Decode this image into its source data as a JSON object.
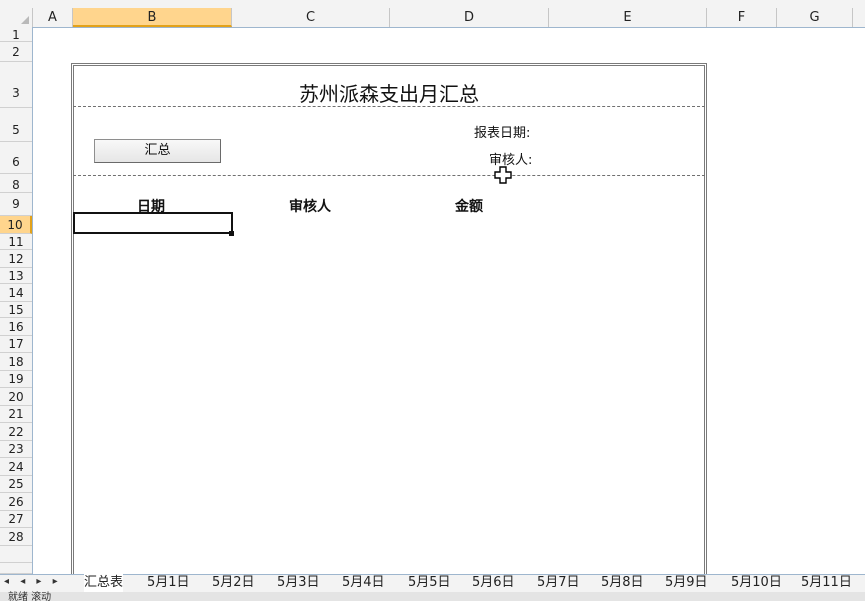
{
  "columns": [
    {
      "label": "A"
    },
    {
      "label": "B"
    },
    {
      "label": "C"
    },
    {
      "label": "D"
    },
    {
      "label": "E"
    },
    {
      "label": "F"
    },
    {
      "label": "G"
    }
  ],
  "rows": [
    "1",
    "2",
    "3",
    "5",
    "6",
    "8",
    "9",
    "10",
    "11",
    "12",
    "13",
    "14",
    "15",
    "16",
    "17",
    "18",
    "19",
    "20",
    "21",
    "22",
    "23",
    "24",
    "25",
    "26",
    "27",
    "28"
  ],
  "active_cell": {
    "column": "B",
    "row": "10"
  },
  "report": {
    "title": "苏州派森支出月汇总",
    "summary_button": "汇总",
    "report_date_label": "报表日期:",
    "reviewer_label": "审核人:",
    "headers": {
      "date": "日期",
      "reviewer": "审核人",
      "amount": "金额"
    }
  },
  "sheet_nav": "◂ ◂ ▸ ▸",
  "sheet_tabs": [
    "汇总表",
    "5月1日",
    "5月2日",
    "5月3日",
    "5月4日",
    "5月5日",
    "5月6日",
    "5月7日",
    "5月8日",
    "5月9日",
    "5月10日",
    "5月11日"
  ],
  "active_tab": "汇总表",
  "status": {
    "text": "就绪   滚动"
  }
}
